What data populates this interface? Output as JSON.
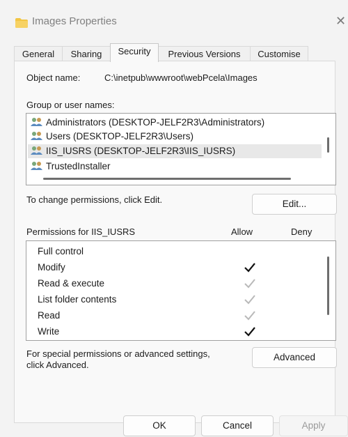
{
  "window": {
    "title": "Images Properties"
  },
  "tabs": [
    {
      "label": "General"
    },
    {
      "label": "Sharing"
    },
    {
      "label": "Security",
      "active": true
    },
    {
      "label": "Previous Versions"
    },
    {
      "label": "Customise"
    }
  ],
  "security": {
    "object_name_label": "Object name:",
    "object_name_value": "C:\\inetpub\\wwwroot\\webPcela\\Images",
    "group_label": "Group or user names:",
    "users": [
      {
        "name": "Administrators (DESKTOP-JELF2R3\\Administrators)"
      },
      {
        "name": "Users (DESKTOP-JELF2R3\\Users)"
      },
      {
        "name": "IIS_IUSRS (DESKTOP-JELF2R3\\IIS_IUSRS)",
        "selected": true
      },
      {
        "name": "TrustedInstaller"
      }
    ],
    "change_text": "To change permissions, click Edit.",
    "edit_button": "Edit...",
    "permissions_label": "Permissions for IIS_IUSRS",
    "allow_header": "Allow",
    "deny_header": "Deny",
    "permissions": [
      {
        "name": "Full control",
        "allow": "none",
        "deny": "none"
      },
      {
        "name": "Modify",
        "allow": "checked",
        "deny": "none"
      },
      {
        "name": "Read & execute",
        "allow": "inherited",
        "deny": "none"
      },
      {
        "name": "List folder contents",
        "allow": "inherited",
        "deny": "none"
      },
      {
        "name": "Read",
        "allow": "inherited",
        "deny": "none"
      },
      {
        "name": "Write",
        "allow": "checked",
        "deny": "none"
      }
    ],
    "special_text_line1": "For special permissions or advanced settings,",
    "special_text_line2": "click Advanced.",
    "advanced_button": "Advanced"
  },
  "footer": {
    "ok": "OK",
    "cancel": "Cancel",
    "apply": "Apply"
  },
  "colors": {
    "check_active": "#111111",
    "check_inherited": "#b9b9b9",
    "folder": "#f2c544"
  },
  "icons": {
    "title": "folder-icon",
    "close": "close-icon",
    "user": "user-group-icon",
    "check": "checkmark-icon"
  }
}
